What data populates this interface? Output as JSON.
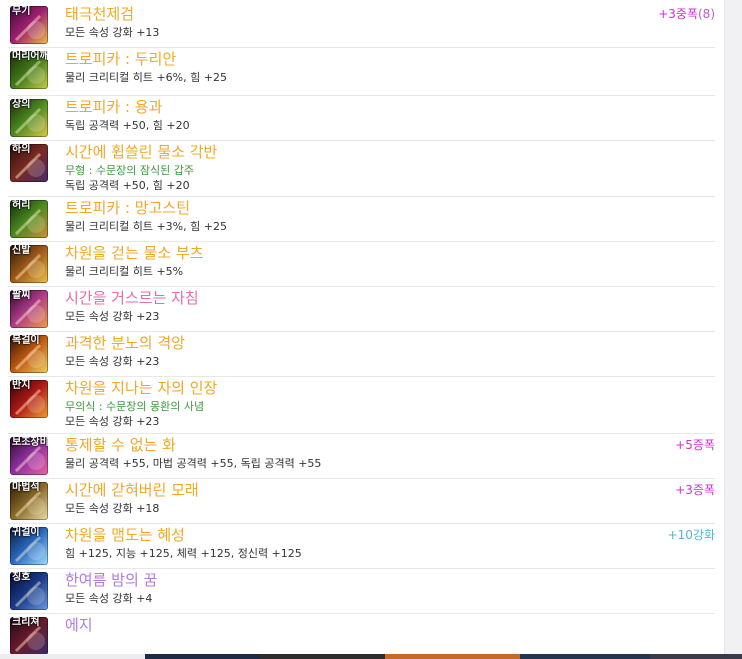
{
  "colors": {
    "unique": "#e8a72a",
    "legendary": "#e0a020",
    "epic": "#e46ea8",
    "rare": "#b07ae0",
    "starforce": "#d02fd0",
    "enhance": "#4fb6d8",
    "green": "#3b9a3b"
  },
  "items": [
    {
      "slot": "무기",
      "name": "태극천제검",
      "name_color": "#f0a828",
      "lines": [
        {
          "text": "모든 속성 강화 +13",
          "kind": "normal"
        }
      ],
      "tag": "+3중폭",
      "tag_count": "(8)",
      "tag_color": "#d02fd0",
      "icon": "sword-icon"
    },
    {
      "slot": "머리어깨",
      "name": "트로피카 : 두리안",
      "name_color": "#f0a828",
      "lines": [
        {
          "text": "물리 크리티컬 히트 +6%, 힘 +25",
          "kind": "normal"
        }
      ],
      "icon": "helmet-icon"
    },
    {
      "slot": "상의",
      "name": "트로피카 : 용과",
      "name_color": "#f0a828",
      "lines": [
        {
          "text": "독립 공격력 +50, 힘 +20",
          "kind": "normal"
        }
      ],
      "icon": "top-armor-icon"
    },
    {
      "slot": "하의",
      "name": "시간에 휩쓸린 물소 각반",
      "name_color": "#f0a828",
      "lines": [
        {
          "text": "무형 : 수문장의 잠식된 갑주",
          "kind": "green"
        },
        {
          "text": "독립 공격력 +50, 힘 +20",
          "kind": "normal"
        }
      ],
      "icon": "pants-icon"
    },
    {
      "slot": "허리",
      "name": "트로피카 : 망고스틴",
      "name_color": "#f0a828",
      "lines": [
        {
          "text": "물리 크리티컬 히트 +3%, 힘 +25",
          "kind": "normal"
        }
      ],
      "icon": "belt-icon"
    },
    {
      "slot": "신발",
      "name": "차원을 걷는 물소 부츠",
      "name_color": "#f0a828",
      "lines": [
        {
          "text": "물리 크리티컬 히트 +5%",
          "kind": "normal"
        }
      ],
      "icon": "boots-icon"
    },
    {
      "slot": "팔찌",
      "name": "시간을 거스르는 자침",
      "name_color": "#e46ea8",
      "lines": [
        {
          "text": "모든 속성 강화 +23",
          "kind": "normal"
        }
      ],
      "icon": "bracelet-icon"
    },
    {
      "slot": "목걸이",
      "name": "과격한 분노의 격앙",
      "name_color": "#f0a828",
      "lines": [
        {
          "text": "모든 속성 강화 +23",
          "kind": "normal"
        }
      ],
      "icon": "necklace-icon"
    },
    {
      "slot": "반지",
      "name": "차원을 지나는 자의 인장",
      "name_color": "#f0a828",
      "lines": [
        {
          "text": "무의식 : 수문장의 몽환의 사념",
          "kind": "green"
        },
        {
          "text": "모든 속성 강화 +23",
          "kind": "normal"
        }
      ],
      "icon": "ring-icon"
    },
    {
      "slot": "보조장비",
      "name": "통제할 수 없는 화",
      "name_color": "#f0a828",
      "lines": [
        {
          "text": "물리 공격력 +55, 마법 공격력 +55, 독립 공격력 +55",
          "kind": "normal"
        }
      ],
      "tag": "+5증폭",
      "tag_color": "#d02fd0",
      "icon": "subweapon-icon"
    },
    {
      "slot": "마법석",
      "name": "시간에 갇혀버린 모래",
      "name_color": "#f0a828",
      "lines": [
        {
          "text": "모든 속성 강화 +18",
          "kind": "normal"
        }
      ],
      "tag": "+3증폭",
      "tag_color": "#d02fd0",
      "icon": "magic-stone-icon"
    },
    {
      "slot": "귀걸이",
      "name": "차원을 맴도는 혜성",
      "name_color": "#f0a828",
      "lines": [
        {
          "text": "힘 +125, 지능 +125, 체력 +125, 정신력 +125",
          "kind": "normal"
        }
      ],
      "tag": "+10강화",
      "tag_color": "#4fb6d8",
      "icon": "earring-icon"
    },
    {
      "slot": "칭호",
      "name": "한여름 밤의 꿈",
      "name_color": "#b07ae0",
      "lines": [
        {
          "text": "모든 속성 강화 +4",
          "kind": "normal"
        }
      ],
      "icon": "title-icon"
    },
    {
      "slot": "크리쳐",
      "name": "에지",
      "name_color": "#b07ae0",
      "lines": [],
      "icon": "creature-icon"
    }
  ]
}
